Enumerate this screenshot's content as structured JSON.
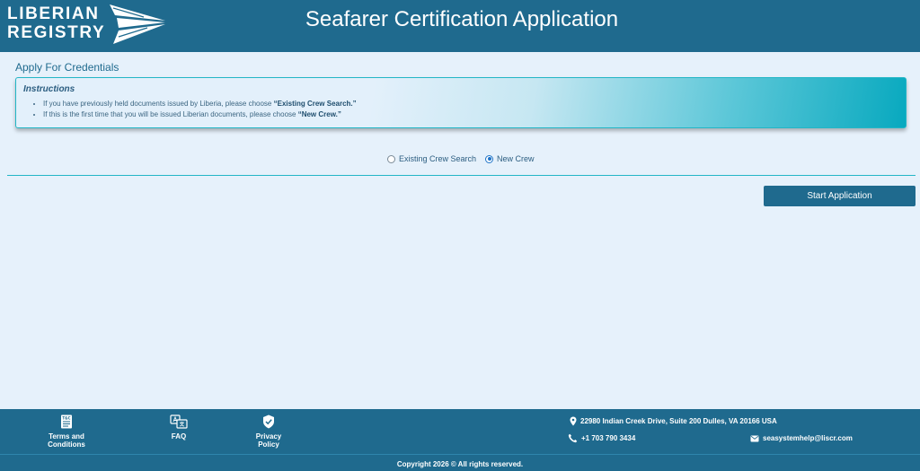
{
  "header": {
    "logo_line1": "LIBERIAN",
    "logo_line2": "REGISTRY",
    "title": "Seafarer Certification Application"
  },
  "main": {
    "section_title": "Apply For Credentials",
    "instructions": {
      "title": "Instructions",
      "items": [
        {
          "text": "If you have previously held documents issued by Liberia, please choose ",
          "emphasis": "“Existing Crew Search.”"
        },
        {
          "text": "If this is the first time that you will be issued Liberian documents, please choose ",
          "emphasis": "“New Crew.”"
        }
      ]
    },
    "options": [
      {
        "label": "Existing Crew Search",
        "checked": false
      },
      {
        "label": "New Crew",
        "checked": true
      }
    ],
    "start_button": "Start Application"
  },
  "footer": {
    "links": [
      {
        "label": "Terms and Conditions",
        "icon": "document-icon"
      },
      {
        "label": "FAQ",
        "icon": "translate-icon"
      },
      {
        "label": "Privacy Policy",
        "icon": "shield-icon"
      }
    ],
    "address": "22980 Indian Creek Drive, Suite 200 Dulles, VA 20166 USA",
    "phone": "+1 703 790 3434",
    "email": "seasystemhelp@liscr.com",
    "copyright": "Copyright 2026 © All rights reserved."
  },
  "colors": {
    "header_bg": "#1f6a8e",
    "page_bg": "#e6f1fb",
    "accent": "#22b6c6",
    "radio_selected": "#1e73c8"
  }
}
